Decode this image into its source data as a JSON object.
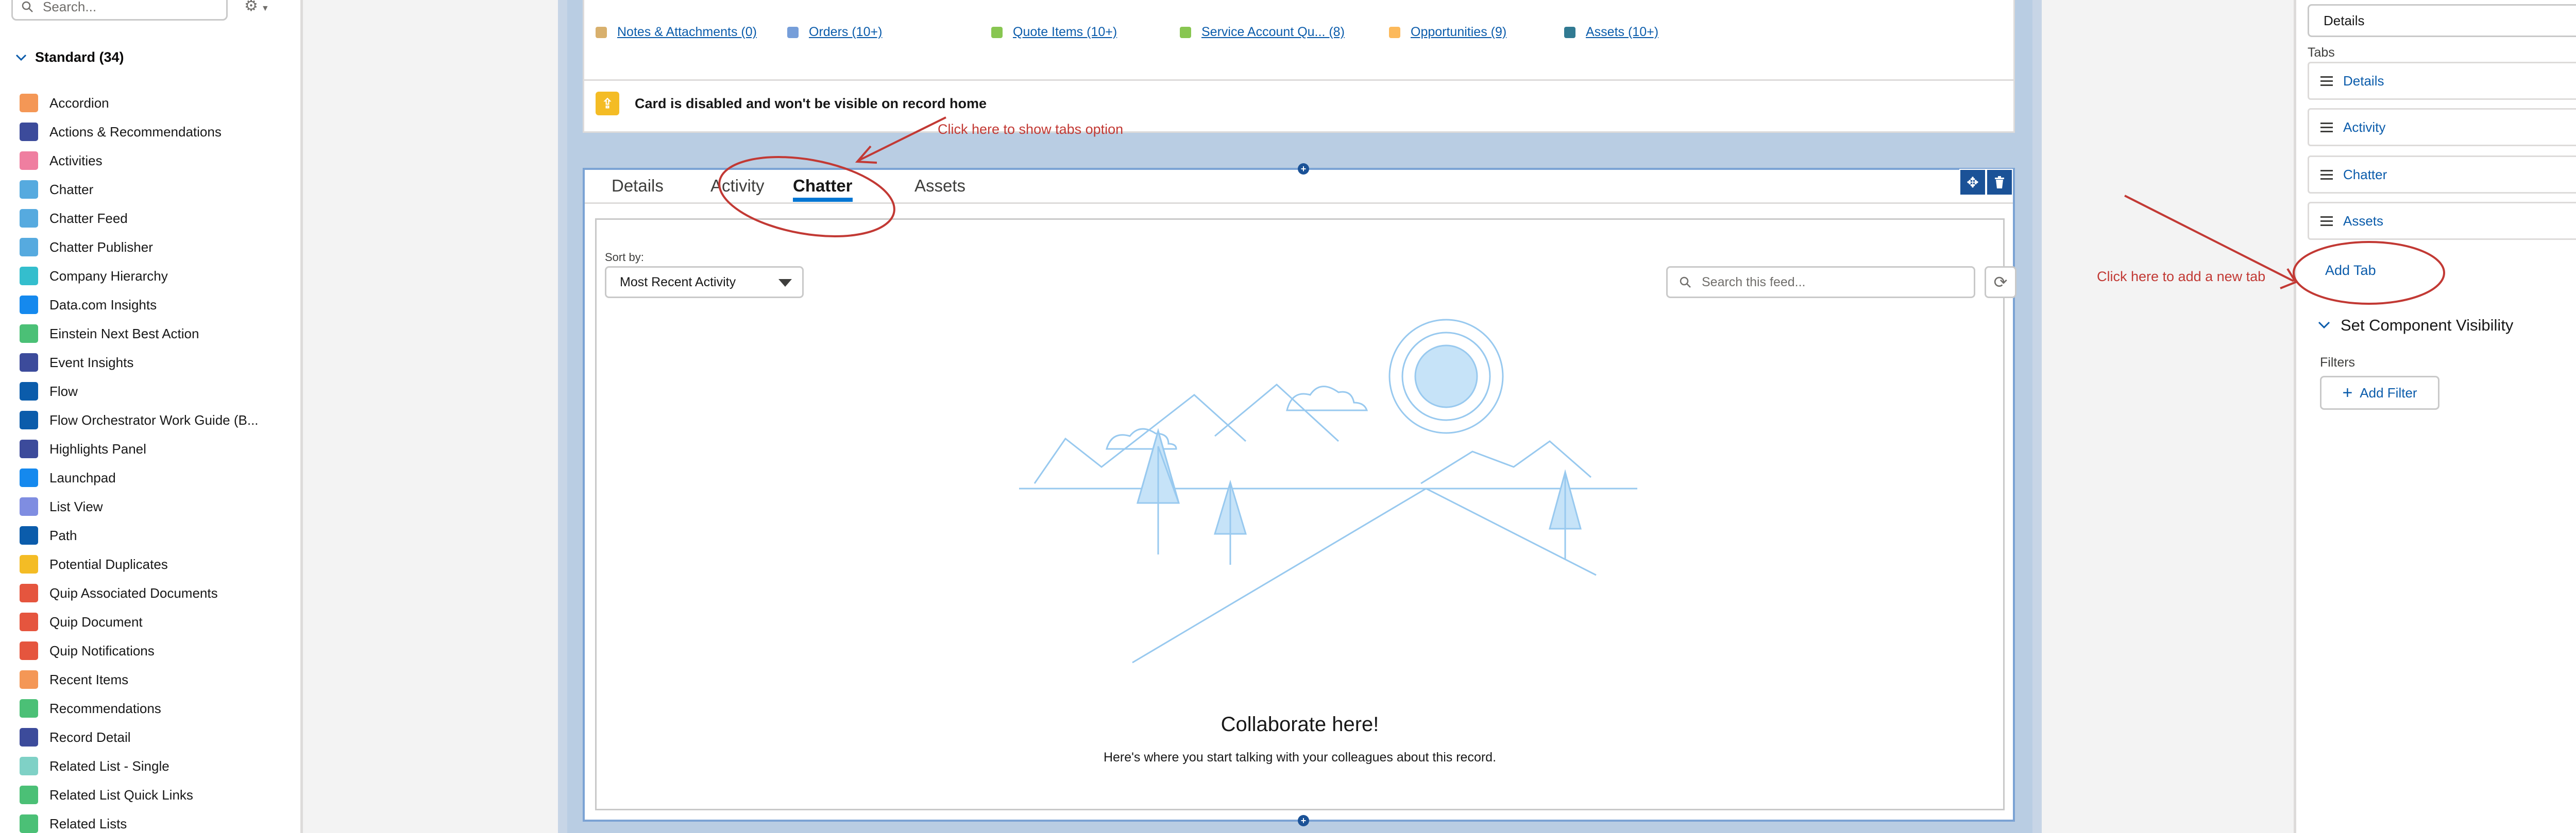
{
  "left_panel": {
    "search_placeholder": "Search...",
    "section_title": "Standard (34)",
    "components": [
      {
        "label": "Accordion",
        "icon": "accordion-icon",
        "color": "#f49756"
      },
      {
        "label": "Actions & Recommendations",
        "icon": "actions-icon",
        "color": "#3c4b9b"
      },
      {
        "label": "Activities",
        "icon": "activities-icon",
        "color": "#ef7ea0"
      },
      {
        "label": "Chatter",
        "icon": "chatter-icon",
        "color": "#56aadf"
      },
      {
        "label": "Chatter Feed",
        "icon": "chatter-feed-icon",
        "color": "#56aadf"
      },
      {
        "label": "Chatter Publisher",
        "icon": "chatter-publisher-icon",
        "color": "#56aadf"
      },
      {
        "label": "Company Hierarchy",
        "icon": "hierarchy-icon",
        "color": "#34becd"
      },
      {
        "label": "Data.com Insights",
        "icon": "datacom-icon",
        "color": "#1589ee"
      },
      {
        "label": "Einstein Next Best Action",
        "icon": "einstein-icon",
        "color": "#4bc076"
      },
      {
        "label": "Event Insights",
        "icon": "event-insights-icon",
        "color": "#3c4b9b"
      },
      {
        "label": "Flow",
        "icon": "flow-icon",
        "color": "#0b5cab"
      },
      {
        "label": "Flow Orchestrator Work Guide (B...",
        "icon": "orchestrator-icon",
        "color": "#0b5cab"
      },
      {
        "label": "Highlights Panel",
        "icon": "highlights-icon",
        "color": "#3c4b9b"
      },
      {
        "label": "Launchpad",
        "icon": "launchpad-icon",
        "color": "#1589ee"
      },
      {
        "label": "List View",
        "icon": "list-view-icon",
        "color": "#7f8de1"
      },
      {
        "label": "Path",
        "icon": "path-icon",
        "color": "#0b5cab"
      },
      {
        "label": "Potential Duplicates",
        "icon": "duplicates-icon",
        "color": "#f4bc25"
      },
      {
        "label": "Quip Associated Documents",
        "icon": "quip-icon",
        "color": "#e5553e"
      },
      {
        "label": "Quip Document",
        "icon": "quip-document-icon",
        "color": "#e5553e"
      },
      {
        "label": "Quip Notifications",
        "icon": "quip-notifications-icon",
        "color": "#e5553e"
      },
      {
        "label": "Recent Items",
        "icon": "recent-icon",
        "color": "#f49756"
      },
      {
        "label": "Recommendations",
        "icon": "recommendations-icon",
        "color": "#4bc076"
      },
      {
        "label": "Record Detail",
        "icon": "record-detail-icon",
        "color": "#3c4b9b"
      },
      {
        "label": "Related List - Single",
        "icon": "related-list-single-icon",
        "color": "#7fd1c6"
      },
      {
        "label": "Related List Quick Links",
        "icon": "related-quick-links-icon",
        "color": "#4bc076"
      },
      {
        "label": "Related Lists",
        "icon": "related-lists-icon",
        "color": "#4bc076"
      }
    ]
  },
  "canvas": {
    "related_links": [
      {
        "label": "Notes & Attachments (0)",
        "color": "#d8b06d"
      },
      {
        "label": "Orders (10+)",
        "color": "#769ed9"
      },
      {
        "label": "Quote Items (10+)",
        "color": "#88c651"
      },
      {
        "label": "Service Account Qu... (8)",
        "color": "#88c651"
      },
      {
        "label": "Opportunities (9)",
        "color": "#fcb95b"
      },
      {
        "label": "Assets (10+)",
        "color": "#317a92"
      }
    ],
    "disabled_warning": "Card is disabled and won't be visible on record home",
    "tabs": [
      "Details",
      "Activity",
      "Chatter",
      "Assets"
    ],
    "active_tab": "Chatter",
    "sort_label": "Sort by:",
    "sort_value": "Most Recent Activity",
    "feed_search_placeholder": "Search this feed...",
    "empty_title": "Collaborate here!",
    "empty_subtitle": "Here's where you start talking with your colleagues about this record."
  },
  "right_panel": {
    "default_tab_value": "Details",
    "tabs_label": "Tabs",
    "tabs": [
      "Details",
      "Activity",
      "Chatter",
      "Assets"
    ],
    "add_tab": "Add Tab",
    "visibility_title": "Set Component Visibility",
    "filters_label": "Filters",
    "add_filter": "Add Filter"
  },
  "annotations": {
    "tabs_option": "Click here to show tabs option",
    "add_tab": "Click here to add a new tab",
    "color": "#c23934"
  }
}
